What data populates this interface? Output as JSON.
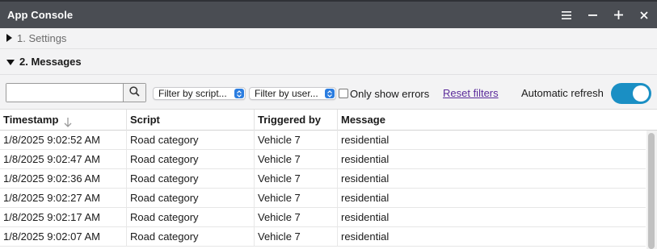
{
  "window": {
    "title": "App Console",
    "controls": [
      "menu-icon",
      "minimize-icon",
      "maximize-icon",
      "close-icon"
    ]
  },
  "sections": {
    "settings": {
      "label": "1. Settings",
      "expanded": false
    },
    "messages": {
      "label": "2. Messages",
      "expanded": true
    }
  },
  "toolbar": {
    "search": {
      "value": "",
      "placeholder": ""
    },
    "filter_script": "Filter by script...",
    "filter_user": "Filter by user...",
    "only_errors_label": "Only show errors",
    "only_errors_checked": false,
    "reset_filters": "Reset filters",
    "auto_refresh_label": "Automatic refresh",
    "auto_refresh_on": true
  },
  "table": {
    "headers": [
      "Timestamp",
      "Script",
      "Triggered by",
      "Message"
    ],
    "sort_column": "Timestamp",
    "sort_direction": "descending",
    "rows": [
      [
        "1/8/2025 9:02:52 AM",
        "Road category",
        "Vehicle 7",
        "residential"
      ],
      [
        "1/8/2025 9:02:47 AM",
        "Road category",
        "Vehicle 7",
        "residential"
      ],
      [
        "1/8/2025 9:02:36 AM",
        "Road category",
        "Vehicle 7",
        "residential"
      ],
      [
        "1/8/2025 9:02:27 AM",
        "Road category",
        "Vehicle 7",
        "residential"
      ],
      [
        "1/8/2025 9:02:17 AM",
        "Road category",
        "Vehicle 7",
        "residential"
      ],
      [
        "1/8/2025 9:02:07 AM",
        "Road category",
        "Vehicle 7",
        "residential"
      ]
    ]
  },
  "colors": {
    "titlebar": "#4a4d53",
    "accent": "#1a8fc4",
    "select_arrow": "#2b7de0",
    "link": "#5a2a9a"
  }
}
